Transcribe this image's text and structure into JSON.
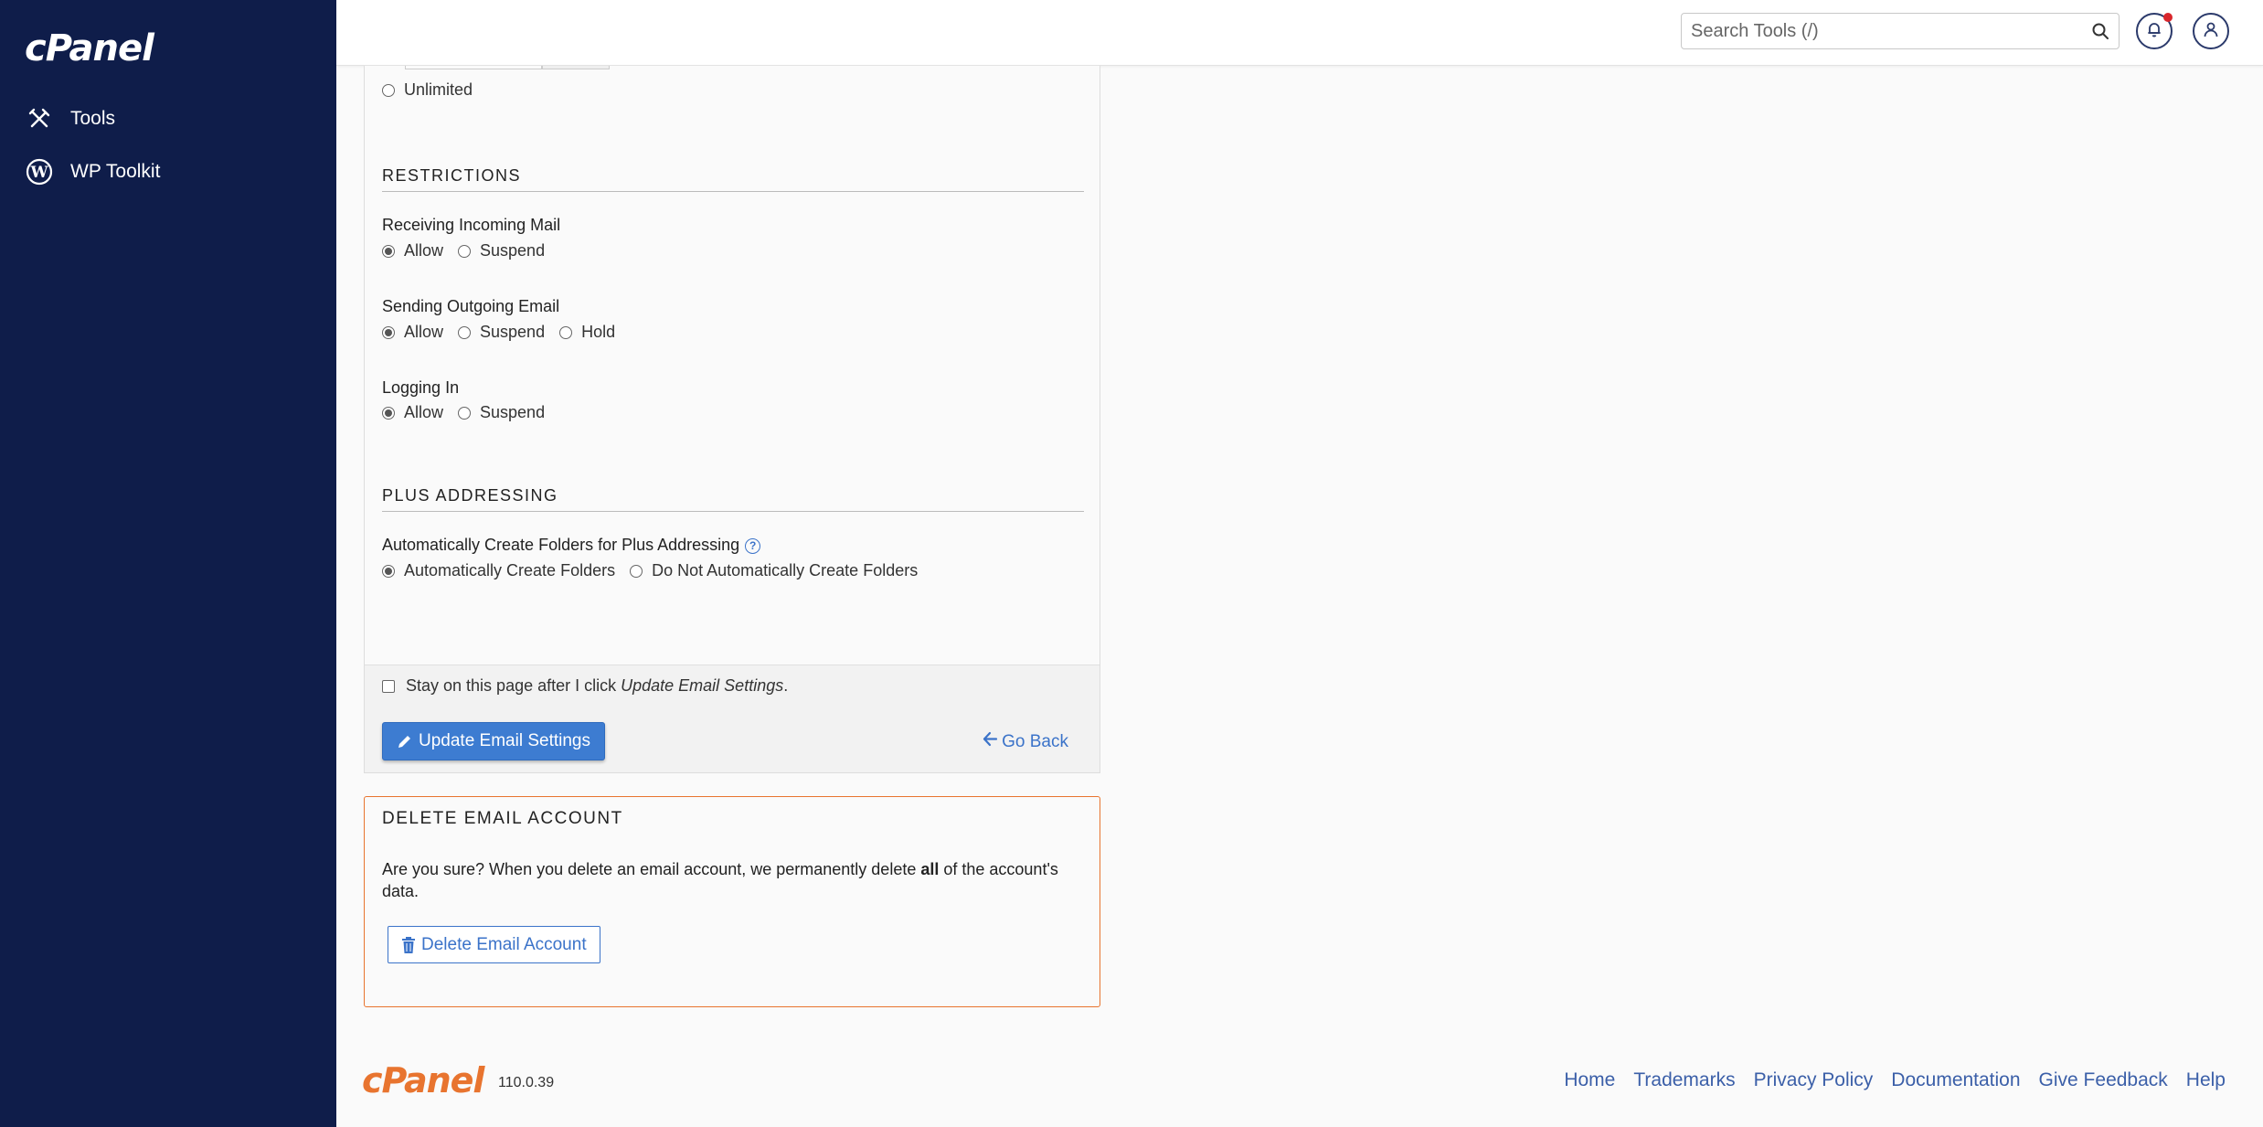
{
  "sidebar": {
    "logo": "cPanel",
    "items": [
      {
        "label": "Tools",
        "icon": "tools-icon"
      },
      {
        "label": "WP Toolkit",
        "icon": "wordpress-icon"
      }
    ]
  },
  "header": {
    "search_placeholder": "Search Tools (/)"
  },
  "quota": {
    "unlimited_label": "Unlimited"
  },
  "restrictions": {
    "title": "RESTRICTIONS",
    "receiving": {
      "label": "Receiving Incoming Mail",
      "options": [
        "Allow",
        "Suspend"
      ],
      "selected": "Allow"
    },
    "sending": {
      "label": "Sending Outgoing Email",
      "options": [
        "Allow",
        "Suspend",
        "Hold"
      ],
      "selected": "Allow"
    },
    "login": {
      "label": "Logging In",
      "options": [
        "Allow",
        "Suspend"
      ],
      "selected": "Allow"
    }
  },
  "plus_addressing": {
    "title": "PLUS ADDRESSING",
    "label": "Automatically Create Folders for Plus Addressing",
    "options": [
      "Automatically Create Folders",
      "Do Not Automatically Create Folders"
    ],
    "selected": "Automatically Create Folders"
  },
  "form_footer": {
    "stay_prefix": "Stay on this page after I click ",
    "stay_emph": "Update Email Settings",
    "stay_suffix": ".",
    "update_button": "Update Email Settings",
    "go_back": "Go Back"
  },
  "delete": {
    "title": "DELETE EMAIL ACCOUNT",
    "text_prefix": "Are you sure? When you delete an email account, we permanently delete ",
    "text_bold": "all",
    "text_suffix": " of the account's data.",
    "button": "Delete Email Account"
  },
  "footer": {
    "logo": "cPanel",
    "version": "110.0.39",
    "links": [
      "Home",
      "Trademarks",
      "Privacy Policy",
      "Documentation",
      "Give Feedback",
      "Help"
    ]
  },
  "colors": {
    "sidebar_bg": "#0f1d4a",
    "primary": "#3d7cd1",
    "danger_border": "#e8742f",
    "link": "#3b5fa8"
  }
}
